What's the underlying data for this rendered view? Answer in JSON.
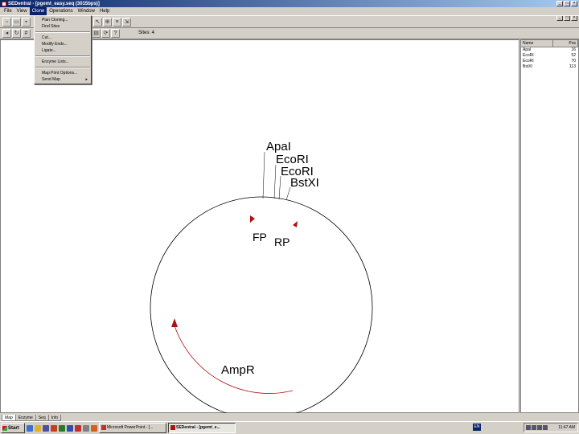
{
  "window": {
    "title": "SEDentral - [pgemt_easy.seq (3015bps)]"
  },
  "menubar": {
    "items": [
      "File",
      "View",
      "Clone",
      "Operations",
      "Window",
      "Help"
    ],
    "active_index": 2
  },
  "clone_menu": {
    "group1": [
      "Plan Cloning...",
      "Find Sites"
    ],
    "group2": [
      "Cut...",
      "Modify Ends...",
      "Ligate..."
    ],
    "group3": [
      "Enzyme Lists..."
    ],
    "group4": [
      {
        "label": "Map Print Options...",
        "arrow": ""
      },
      {
        "label": "Send Map",
        "arrow": "▸"
      }
    ]
  },
  "toolbar": {
    "sites_label": "Sites: 4"
  },
  "map": {
    "sites": [
      "ApaI",
      "EcoRI",
      "EcoRI",
      "BstXI"
    ],
    "features": {
      "fp": "FP",
      "rp": "RP",
      "ampr": "AmpR"
    },
    "colors": {
      "feature": "#b01010",
      "backbone": "#000000"
    }
  },
  "side_panel": {
    "headers": {
      "name": "Name",
      "pos": "Pos"
    },
    "rows": [
      {
        "name": "ApaI",
        "pos": "16"
      },
      {
        "name": "EcoRI",
        "pos": "52"
      },
      {
        "name": "EcoRI",
        "pos": "70"
      },
      {
        "name": "BstXI",
        "pos": "113"
      }
    ]
  },
  "view_tabs": [
    "Map",
    "Enzyme",
    "Seq",
    "Info"
  ],
  "taskbar": {
    "start": "Start",
    "tasks": [
      {
        "label": "Microsoft PowerPoint - [..."
      },
      {
        "label": "SEDentral - [pgemt_e..."
      }
    ],
    "lang": "EN",
    "clock": "11:47 AM"
  }
}
